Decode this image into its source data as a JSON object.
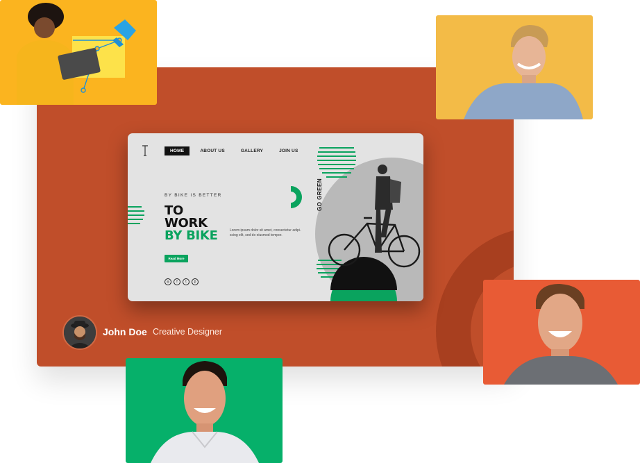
{
  "mockup": {
    "nav": [
      "HOME",
      "ABOUT US",
      "GALLERY",
      "JOIN US"
    ],
    "kicker": "BY BIKE IS BETTER",
    "headline": [
      "TO",
      "WORK",
      "BY BIKE"
    ],
    "body": "Lorem ipsum dolor sit amet, consectetur adipi-scing elit, sed do eiusmod tempor.",
    "button": "Read More",
    "vertical_text": "GO GREEN",
    "social_icons": [
      "instagram-icon",
      "facebook-icon",
      "twitter-icon",
      "pinterest-icon"
    ]
  },
  "profile": {
    "name": "John Doe",
    "role": "Creative Designer"
  },
  "colors": {
    "panel": "#c04e2a",
    "accent_green": "#0aa35e",
    "tile_yellow": "#fbb41f",
    "tile_mustard": "#f3bb47",
    "tile_orange": "#e85b35",
    "tile_green": "#06b06a"
  }
}
